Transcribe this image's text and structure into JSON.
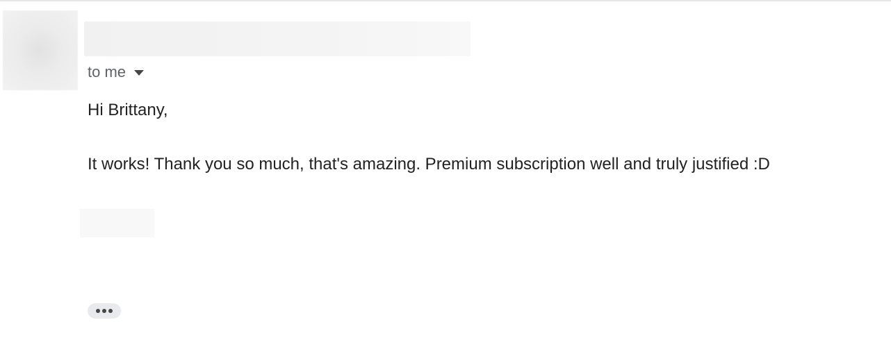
{
  "email": {
    "recipient_label": "to me",
    "greeting": "Hi Brittany,",
    "body": "It works! Thank you so much, that's amazing. Premium subscription well and truly justified :D"
  },
  "icons": {
    "recipient_toggle": "chevron-down-icon",
    "trimmed_content": "more-horizontal-icon"
  },
  "colors": {
    "text": "#222222",
    "secondary_text": "#5f6368",
    "ellipsis_bg": "#e8eaed"
  }
}
